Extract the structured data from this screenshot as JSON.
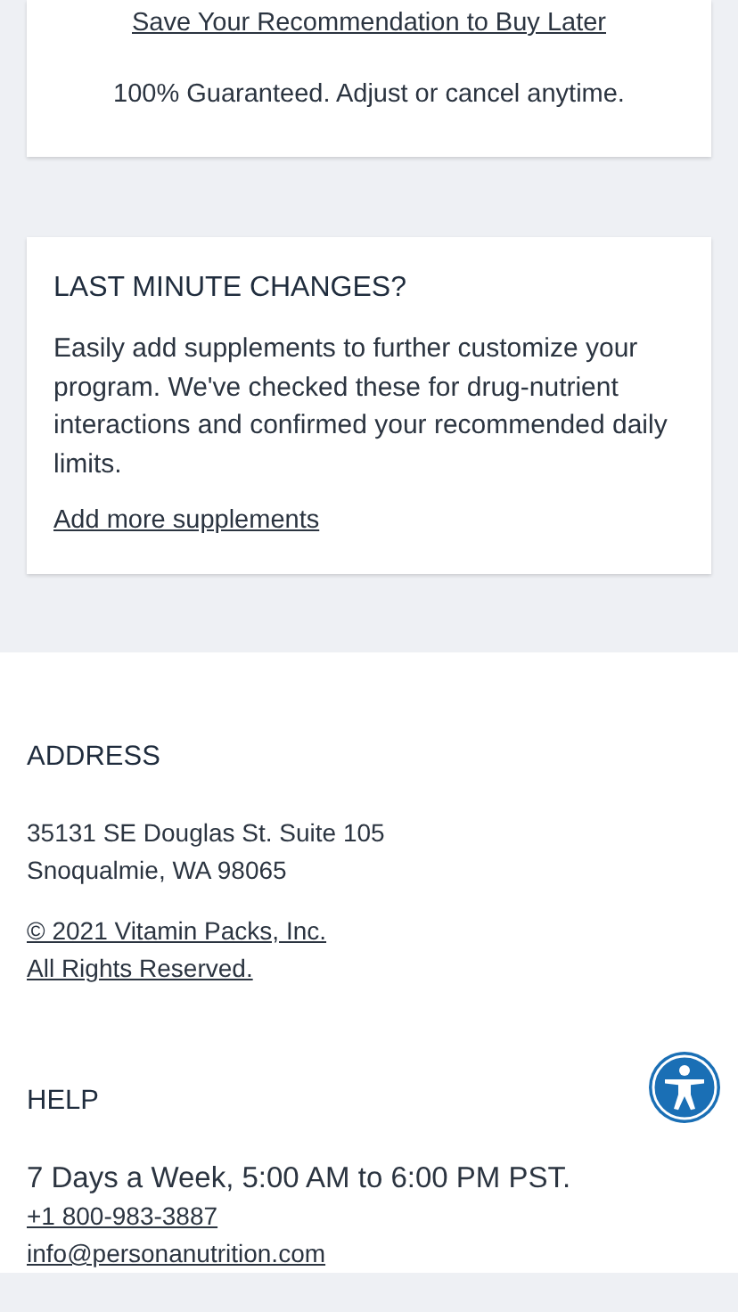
{
  "save_card": {
    "link": "Save Your Recommendation to Buy Later",
    "note": "100% Guaranteed. Adjust or cancel anytime."
  },
  "changes_card": {
    "title": "LAST MINUTE CHANGES?",
    "text": "Easily add supplements to further customize your program. We've checked these for drug-nutrient interactions and confirmed your recommended daily limits.",
    "link": "Add more supplements"
  },
  "footer": {
    "sections": [
      {
        "title": "ADDRESS",
        "lines": [
          {
            "kind": "text",
            "text": "35131 SE Douglas St. Suite 105"
          },
          {
            "kind": "text",
            "text": "Snoqualmie, WA 98065"
          },
          {
            "kind": "spacer"
          },
          {
            "kind": "link",
            "text": "© 2021 Vitamin Packs, Inc."
          },
          {
            "kind": "link",
            "text": "All Rights Reserved."
          }
        ]
      },
      {
        "title": "HELP",
        "lines": [
          {
            "kind": "large",
            "text": "7 Days a Week, 5:00 AM to 6:00 PM PST."
          },
          {
            "kind": "link",
            "text": "+1 800-983-3887"
          },
          {
            "kind": "link",
            "text": "info@personanutrition.com"
          }
        ]
      }
    ]
  }
}
